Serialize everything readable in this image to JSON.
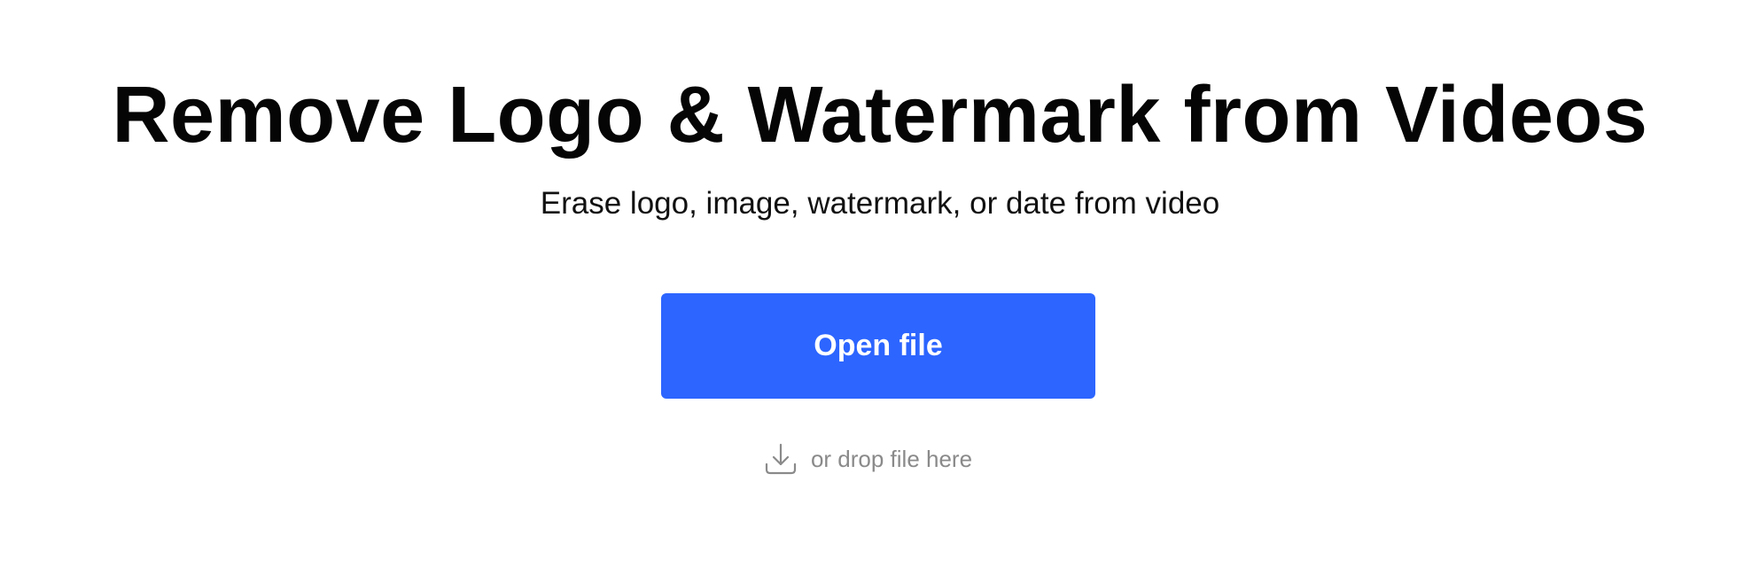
{
  "hero": {
    "title": "Remove Logo & Watermark from Videos",
    "subtitle": "Erase logo, image, watermark, or date from video"
  },
  "upload": {
    "button_label": "Open file",
    "drop_hint": "or drop file here",
    "drop_icon": "download-icon"
  },
  "colors": {
    "accent": "#2c65ff",
    "title": "#050505",
    "hint": "#8a8a8a",
    "background": "#ffffff"
  }
}
